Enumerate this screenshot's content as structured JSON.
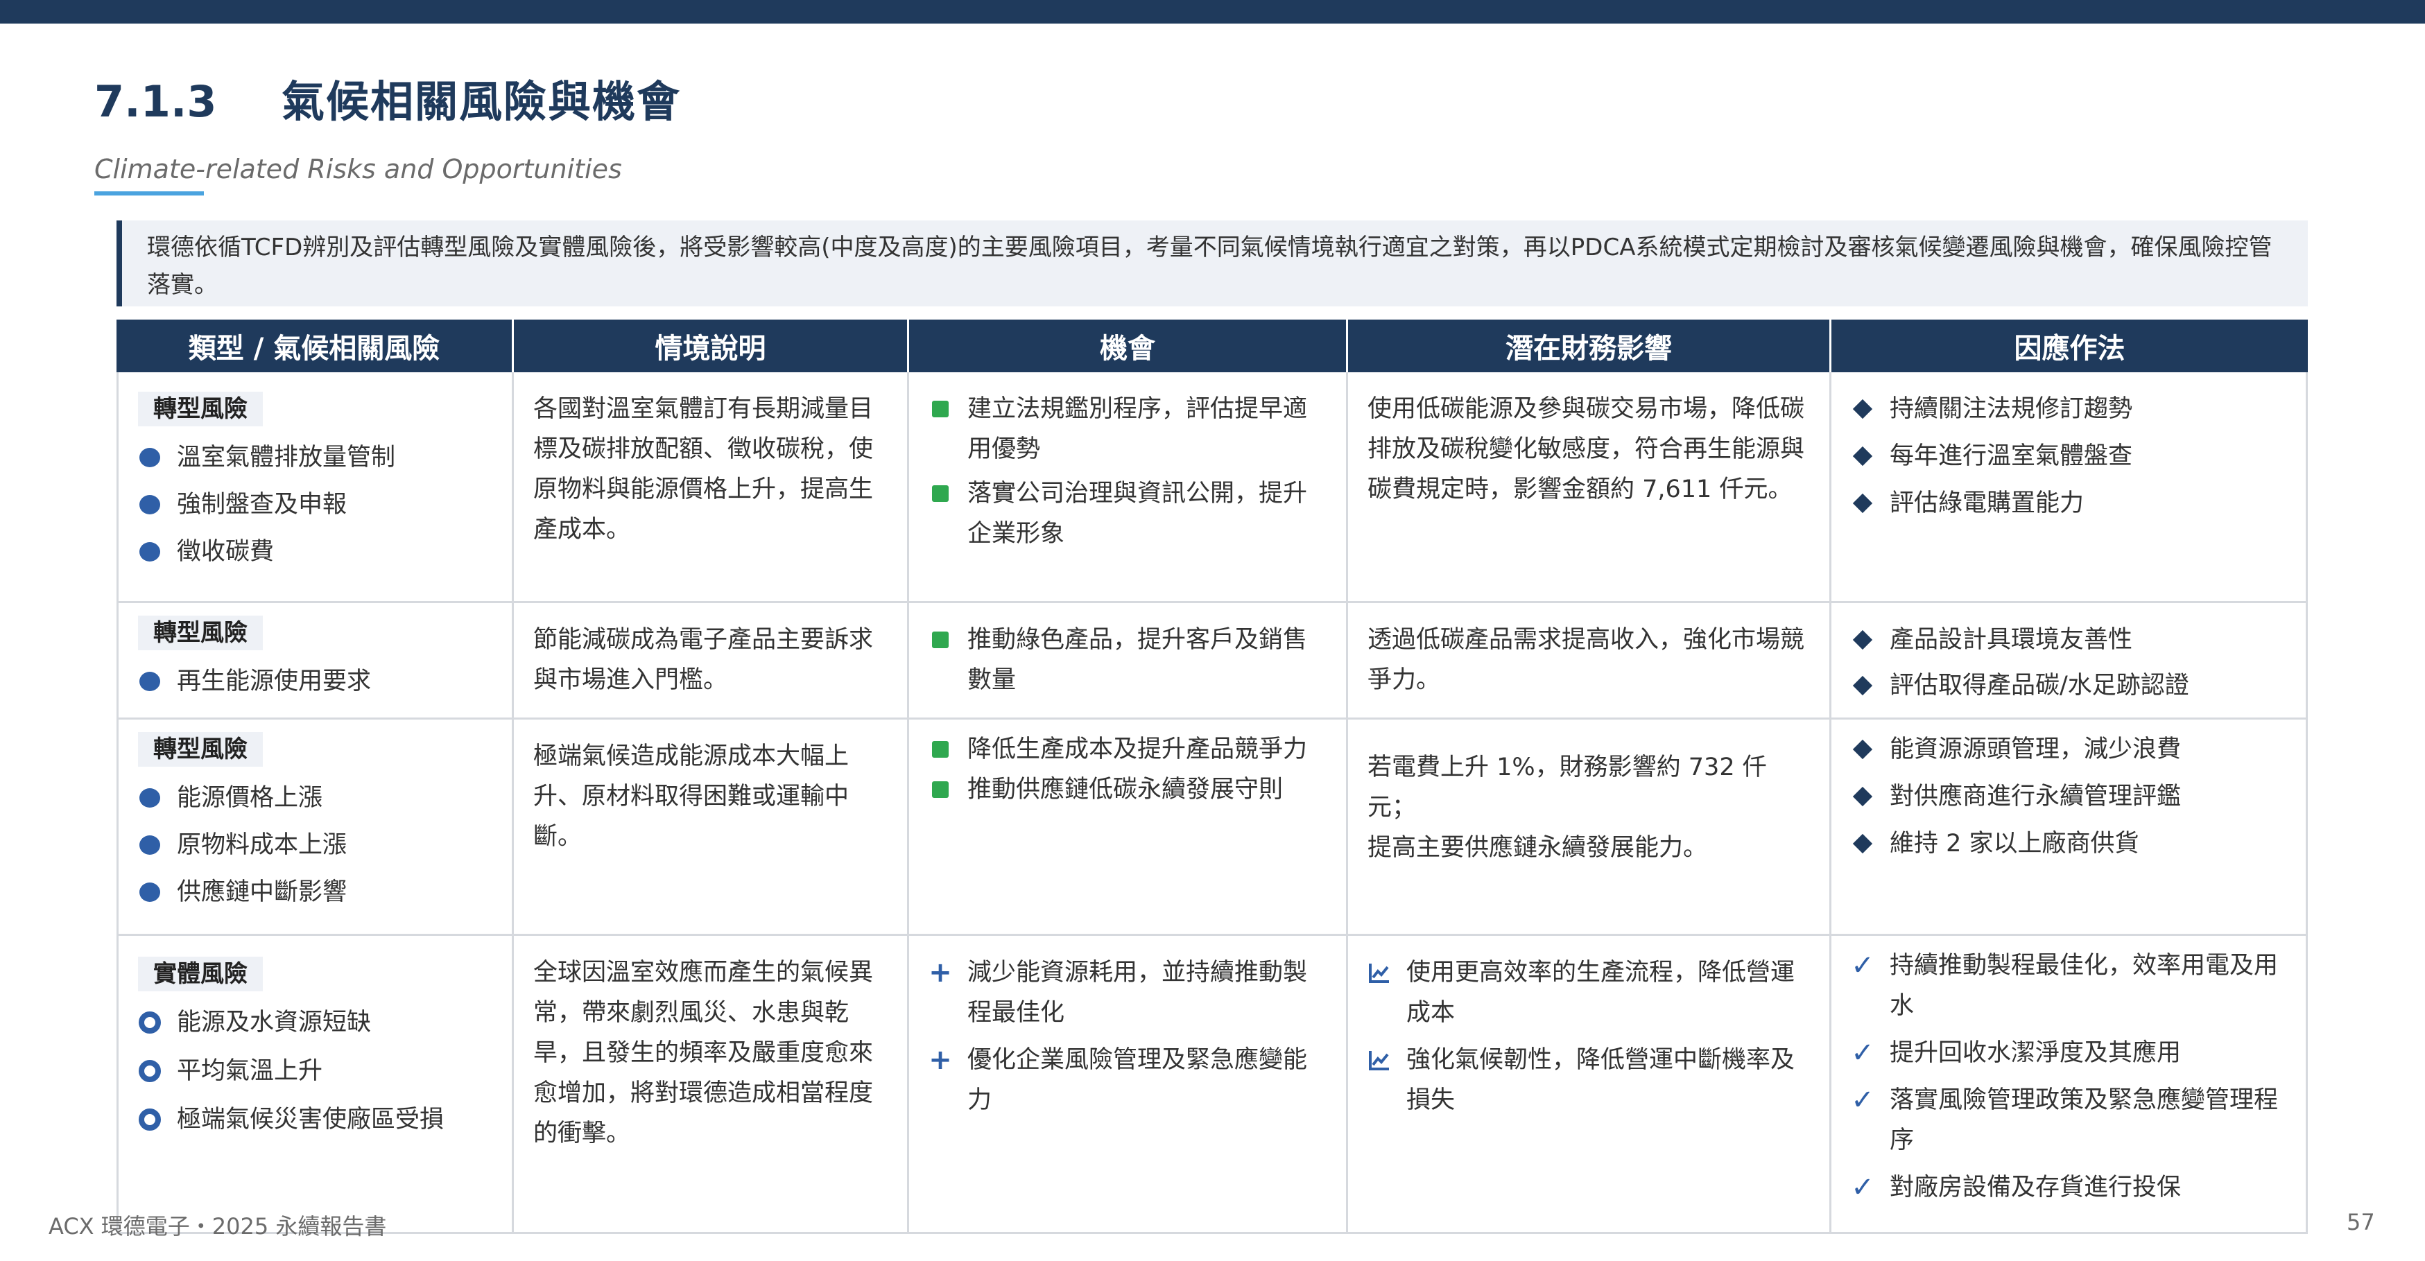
{
  "header": {
    "section_number": "7.1.3",
    "title": "氣候相關風險與機會",
    "subtitle": "Climate-related Risks and Opportunities"
  },
  "intro_text": "環德依循TCFD辨別及評估轉型風險及實體風險後，將受影響較高(中度及高度)的主要風險項目，考量不同氣候情境執行適宜之對策，再以PDCA系統模式定期檢討及審核氣候變遷風險與機會，確保風險控管落實。",
  "table": {
    "headers": [
      "類型 / 氣候相關風險",
      "情境說明",
      "機會",
      "潛在財務影響",
      "因應作法"
    ],
    "rows": [
      {
        "tag": "轉型風險",
        "risks": [
          "溫室氣體排放量管制",
          "強制盤查及申報",
          "徵收碳費"
        ],
        "scenario": "各國對溫室氣體訂有長期減量目標及碳排放配額、徵收碳稅，使原物料與能源價格上升，提高生產成本。",
        "opportunities": [
          "建立法規鑑別程序，評估提早適用優勢",
          "落實公司治理與資訊公開，提升企業形象"
        ],
        "impact": "使用低碳能源及參與碳交易市場，降低碳排放及碳稅變化敏感度，符合再生能源與碳費規定時，影響金額約 7,611 仟元。",
        "actions": [
          "持續關注法規修訂趨勢",
          "每年進行溫室氣體盤查",
          "評估綠電購置能力"
        ]
      },
      {
        "tag": "轉型風險",
        "risks": [
          "再生能源使用要求"
        ],
        "scenario": "節能減碳成為電子產品主要訴求與市場進入門檻。",
        "opportunities": [
          "推動綠色產品，提升客戶及銷售數量"
        ],
        "impact": "透過低碳產品需求提高收入，強化市場競爭力。",
        "actions": [
          "產品設計具環境友善性",
          "評估取得產品碳/水足跡認證"
        ]
      },
      {
        "tag": "轉型風險",
        "risks": [
          "能源價格上漲",
          "原物料成本上漲",
          "供應鏈中斷影響"
        ],
        "scenario": "極端氣候造成能源成本大幅上升、原材料取得困難或運輸中斷。",
        "opportunities": [
          "降低生產成本及提升產品競爭力",
          "推動供應鏈低碳永續發展守則"
        ],
        "impact_lines": [
          "若電費上升 1%，財務影響約 732 仟元；",
          "提高主要供應鏈永續發展能力。"
        ],
        "actions": [
          "能資源源頭管理，減少浪費",
          "對供應商進行永續管理評鑑",
          "維持 2 家以上廠商供貨"
        ]
      },
      {
        "tag": "實體風險",
        "risks": [
          "能源及水資源短缺",
          "平均氣溫上升",
          "極端氣候災害使廠區受損"
        ],
        "scenario": "全球因溫室效應而產生的氣候異常，帶來劇烈風災、水患與乾旱，且發生的頻率及嚴重度愈來愈增加，將對環德造成相當程度的衝擊。",
        "opportunities": [
          "減少能資源耗用，並持續推動製程最佳化",
          "優化企業風險管理及緊急應變能力"
        ],
        "impact_items": [
          "使用更高效率的生產流程，降低營運成本",
          "強化氣候韌性，降低營運中斷機率及損失"
        ],
        "actions": [
          "持續推動製程最佳化，效率用電及用水",
          "提升回收水潔淨度及其應用",
          "落實風險管理政策及緊急應變管理程序",
          "對廠房設備及存貨進行投保"
        ]
      }
    ]
  },
  "footer": {
    "left": "ACX 環德電子・2025 永續報告書",
    "page": "57"
  },
  "colors": {
    "navy": "#1f3a5c",
    "accent_blue": "#4aa3df",
    "bullet_blue": "#2f5fa7",
    "green": "#2fa84f"
  }
}
